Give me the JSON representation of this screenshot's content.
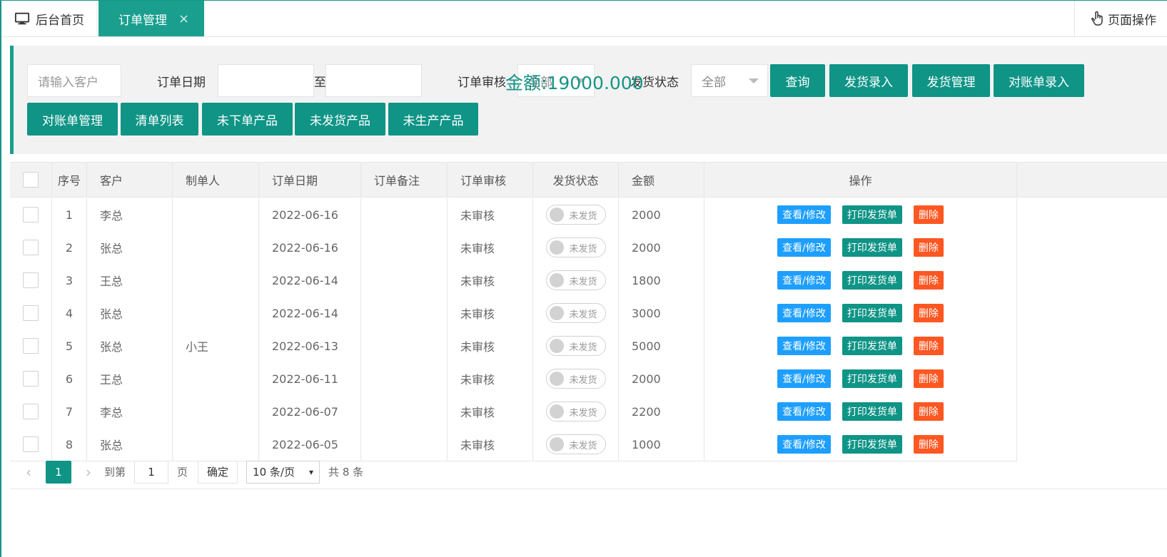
{
  "tabs": {
    "home_label": "后台首页",
    "active_label": "订单管理",
    "close_glyph": "×",
    "page_ops_label": "页面操作"
  },
  "search": {
    "customer_placeholder": "请输入客户",
    "order_date_label": "订单日期",
    "to_label": "至",
    "audit_label": "订单审核",
    "audit_value": "全部",
    "ship_label": "发货状态",
    "ship_value": "全部",
    "buttons": {
      "query": "查询",
      "ship_entry": "发货录入",
      "ship_manage": "发货管理",
      "statement_entry": "对账单录入",
      "statement_manage": "对账单管理",
      "list": "清单列表",
      "not_ordered": "未下单产品",
      "not_shipped": "未发货产品",
      "not_produced": "未生产产品"
    },
    "amount": "金额:19000.000"
  },
  "table": {
    "headers": [
      "序号",
      "客户",
      "制单人",
      "订单日期",
      "订单备注",
      "订单审核",
      "发货状态",
      "金额",
      "操作"
    ],
    "action_labels": {
      "view": "查看/修改",
      "print": "打印发货单",
      "delete": "删除"
    },
    "rows": [
      {
        "no": "1",
        "customer": "李总",
        "maker": "",
        "date": "2022-06-16",
        "note": "",
        "audit": "未审核",
        "ship": "未发货",
        "amount": "2000"
      },
      {
        "no": "2",
        "customer": "张总",
        "maker": "",
        "date": "2022-06-16",
        "note": "",
        "audit": "未审核",
        "ship": "未发货",
        "amount": "2000"
      },
      {
        "no": "3",
        "customer": "王总",
        "maker": "",
        "date": "2022-06-14",
        "note": "",
        "audit": "未审核",
        "ship": "未发货",
        "amount": "1800"
      },
      {
        "no": "4",
        "customer": "张总",
        "maker": "",
        "date": "2022-06-14",
        "note": "",
        "audit": "未审核",
        "ship": "未发货",
        "amount": "3000"
      },
      {
        "no": "5",
        "customer": "张总",
        "maker": "小王",
        "date": "2022-06-13",
        "note": "",
        "audit": "未审核",
        "ship": "未发货",
        "amount": "5000"
      },
      {
        "no": "6",
        "customer": "王总",
        "maker": "",
        "date": "2022-06-11",
        "note": "",
        "audit": "未审核",
        "ship": "未发货",
        "amount": "2000"
      },
      {
        "no": "7",
        "customer": "李总",
        "maker": "",
        "date": "2022-06-07",
        "note": "",
        "audit": "未审核",
        "ship": "未发货",
        "amount": "2200"
      },
      {
        "no": "8",
        "customer": "张总",
        "maker": "",
        "date": "2022-06-05",
        "note": "",
        "audit": "未审核",
        "ship": "未发货",
        "amount": "1000"
      }
    ]
  },
  "pager": {
    "prev_glyph": "‹",
    "current_page": "1",
    "next_glyph": "›",
    "goto_label": "到第",
    "goto_value": "1",
    "page_unit": "页",
    "confirm_label": "确定",
    "page_size": "10 条/页",
    "total_label": "共 8 条"
  },
  "colors": {
    "primary": "#0f9486",
    "info": "#1e9fff",
    "danger": "#ff5722"
  }
}
